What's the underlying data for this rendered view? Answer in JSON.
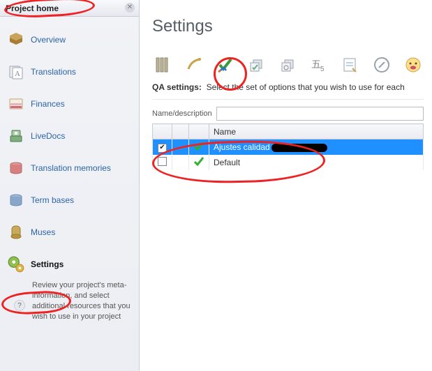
{
  "sidebar": {
    "tab_title": "Project home",
    "items": [
      {
        "label": "Overview"
      },
      {
        "label": "Translations"
      },
      {
        "label": "Finances"
      },
      {
        "label": "LiveDocs"
      },
      {
        "label": "Translation memories"
      },
      {
        "label": "Term bases"
      },
      {
        "label": "Muses"
      },
      {
        "label": "Settings"
      }
    ],
    "settings_desc": "Review your project's meta-information, and select additional resources that you wish to use in your project"
  },
  "main": {
    "heading": "Settings",
    "hint_label": "QA settings:",
    "hint_text": "Select the set of options that you wish to use for each",
    "filter_label": "Name/description",
    "filter_value": "",
    "grid": {
      "name_header": "Name",
      "rows": [
        {
          "checked": true,
          "name": "Ajustes calidad",
          "redacted": true,
          "selected": true
        },
        {
          "checked": false,
          "name": "Default",
          "redacted": false,
          "selected": false
        }
      ]
    }
  }
}
